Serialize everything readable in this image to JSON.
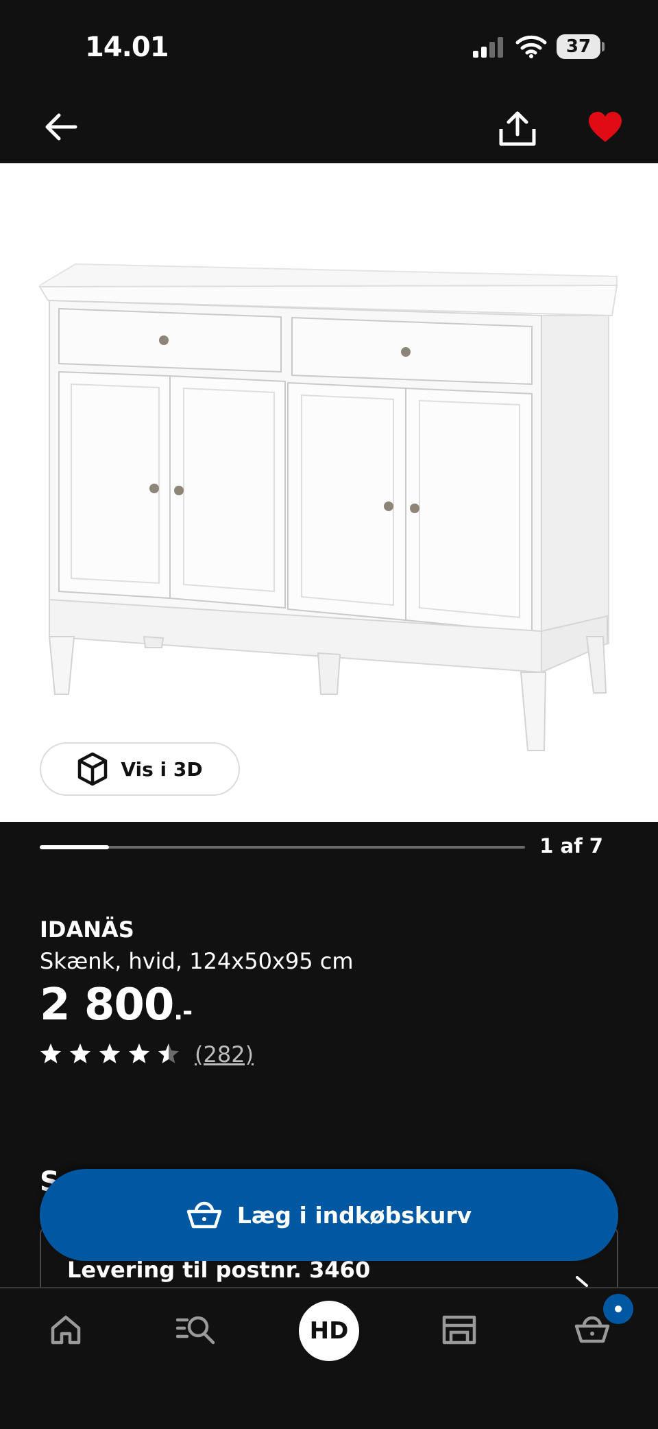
{
  "status_bar": {
    "time": "14.01",
    "battery": "37"
  },
  "product": {
    "name": "IDANÄS",
    "description": "Skænk, hvid, 124x50x95 cm",
    "price": "2 800",
    "price_suffix": ".-",
    "rating": 4.5,
    "rating_count": "(282)",
    "is_favorite": true
  },
  "gallery": {
    "view_3d_label": "Vis i 3D",
    "counter": "1 af 7",
    "current": 1,
    "total": 7
  },
  "cta": {
    "add_to_cart_label": "Læg i indkøbskurv"
  },
  "delivery": {
    "label": "Levering til postnr. 3460",
    "section_heading_partial": "S"
  },
  "bottom_nav": {
    "items": [
      "home",
      "search",
      "store",
      "cart"
    ],
    "store_badge": "HD"
  },
  "colors": {
    "background": "#111111",
    "accent": "#0058a3",
    "favorite": "#e00b14",
    "white": "#ffffff"
  }
}
